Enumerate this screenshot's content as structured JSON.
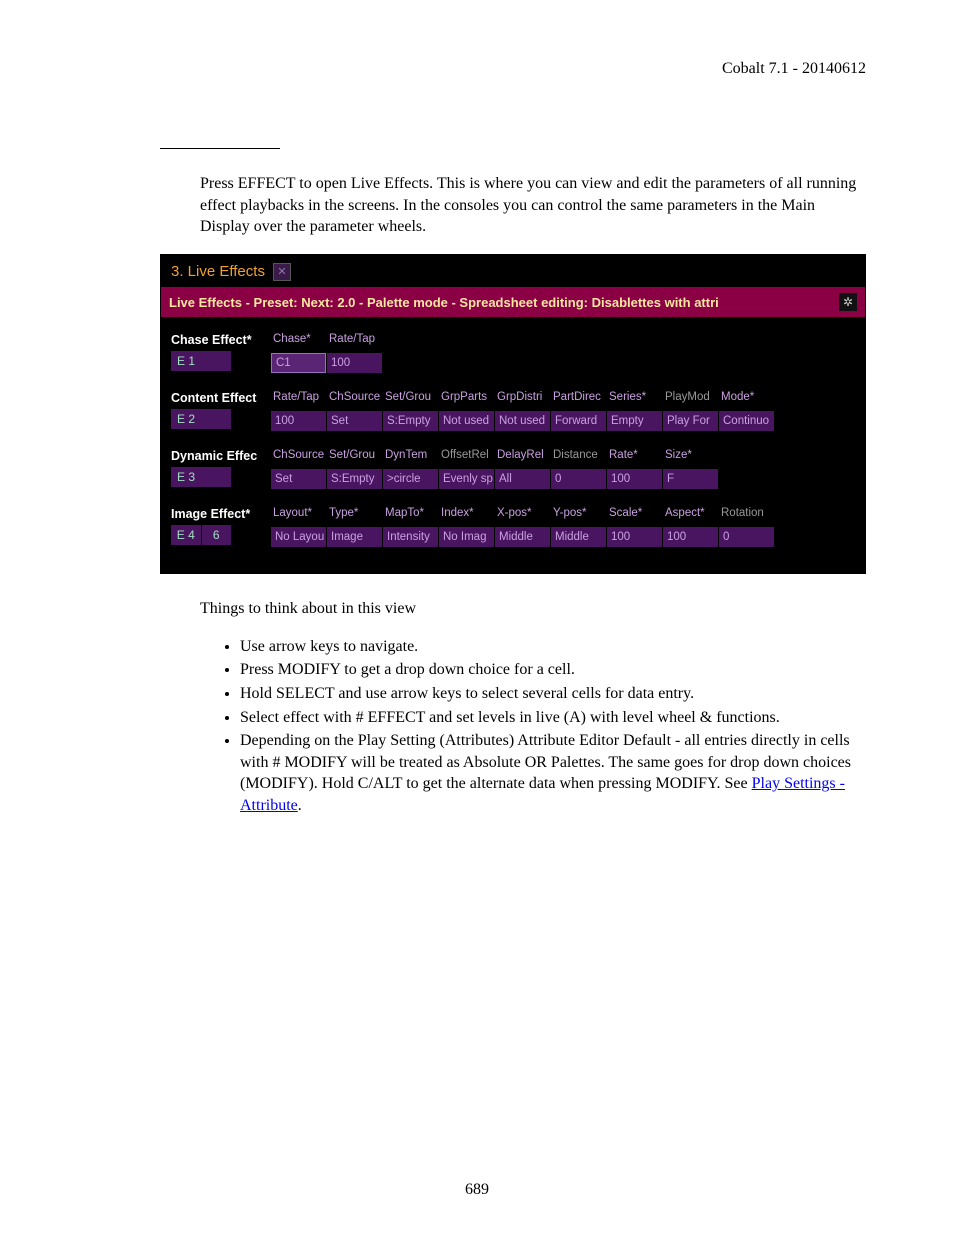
{
  "header": "Cobalt 7.1 - 20140612",
  "intro": "Press EFFECT to open Live Effects. This is where you can view and edit the parameters of all running effect playbacks in the screens. In the consoles you can control the same parameters in the Main Display over the parameter wheels.",
  "tab_title": "3. Live Effects",
  "titlebar": "Live Effects - Preset:  Next: 2.0 - Palette mode - Spreadsheet editing: Disablettes with attri",
  "chase": {
    "label": "Chase Effect*",
    "slot": "E 1",
    "cols": [
      {
        "h": "Chase*",
        "v": "C1",
        "sel": true
      },
      {
        "h": "Rate/Tap",
        "v": "100"
      }
    ]
  },
  "content": {
    "label": "Content Effect",
    "slot": "E 2",
    "cols": [
      {
        "h": "Rate/Tap",
        "v": "100"
      },
      {
        "h": "ChSource",
        "v": "Set"
      },
      {
        "h": "Set/Grou",
        "v": "S:Empty"
      },
      {
        "h": "GrpParts",
        "v": "Not used"
      },
      {
        "h": "GrpDistri",
        "v": "Not used"
      },
      {
        "h": "PartDirec",
        "v": "Forward"
      },
      {
        "h": "Series*",
        "v": "Empty"
      },
      {
        "h": "PlayMod",
        "v": "Play For",
        "grey": true
      },
      {
        "h": "Mode*",
        "v": "Continuo"
      }
    ]
  },
  "dynamic": {
    "label": "Dynamic Effec",
    "slot": "E 3",
    "cols": [
      {
        "h": "ChSource",
        "v": "Set"
      },
      {
        "h": "Set/Grou",
        "v": "S:Empty"
      },
      {
        "h": "DynTem",
        "v": ">circle"
      },
      {
        "h": "OffsetRel",
        "v": "Evenly sp",
        "grey": true
      },
      {
        "h": "DelayRel",
        "v": "All"
      },
      {
        "h": "Distance",
        "v": "0",
        "grey": true
      },
      {
        "h": "Rate*",
        "v": "100"
      },
      {
        "h": "Size*",
        "v": "F"
      }
    ]
  },
  "image": {
    "label": "Image Effect*",
    "slot_a": "E 4",
    "slot_b": "6",
    "cols": [
      {
        "h": "Layout*",
        "v": "No Layou"
      },
      {
        "h": "Type*",
        "v": "Image"
      },
      {
        "h": "MapTo*",
        "v": "Intensity"
      },
      {
        "h": "Index*",
        "v": "No Imag"
      },
      {
        "h": "X-pos*",
        "v": "Middle"
      },
      {
        "h": "Y-pos*",
        "v": "Middle"
      },
      {
        "h": "Scale*",
        "v": "100"
      },
      {
        "h": "Aspect*",
        "v": "100"
      },
      {
        "h": "Rotation",
        "v": "0",
        "grey": true
      }
    ]
  },
  "after_heading": "Things to think about in this view",
  "bullets": [
    "Use arrow keys to navigate.",
    "Press MODIFY to get a drop down choice for a cell.",
    "Hold SELECT and use arrow keys to select several cells for data entry.",
    "Select effect with # EFFECT and set levels in live (A) with level wheel & functions."
  ],
  "bullet5_a": "Depending on the Play Setting (Attributes) Attribute Editor Default - all entries directly in cells with # MODIFY will be treated as Absolute OR Palettes. The same goes for drop down choices (MODIFY). Hold C/ALT to get the alternate data when pressing MODIFY. See ",
  "bullet5_link": "Play Settings - Attribute",
  "bullet5_b": ".",
  "page_number": "689"
}
